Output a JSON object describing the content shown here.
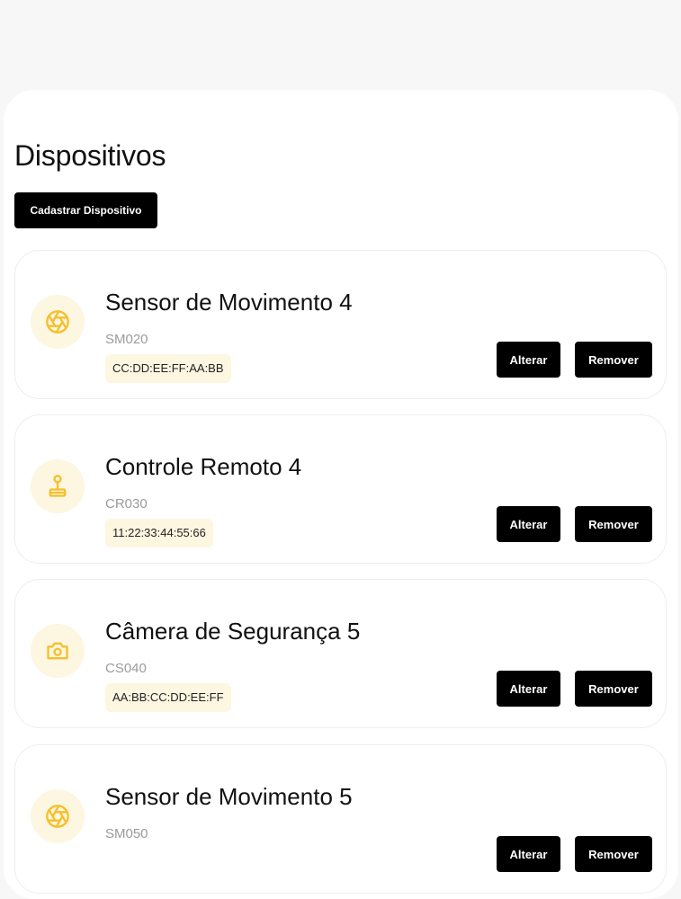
{
  "page": {
    "title": "Dispositivos",
    "add_button_label": "Cadastrar Dispositivo"
  },
  "colors": {
    "icon_accent": "#f5c02c",
    "icon_background": "#fdf6e1",
    "button_background": "#000000",
    "muted_text": "#9b9b9b"
  },
  "devices": [
    {
      "name": "Sensor de Movimento 4",
      "code": "SM020",
      "mac": "CC:DD:EE:FF:AA:BB",
      "icon": "aperture-icon",
      "edit_label": "Alterar",
      "remove_label": "Remover"
    },
    {
      "name": "Controle Remoto 4",
      "code": "CR030",
      "mac": "11:22:33:44:55:66",
      "icon": "joystick-icon",
      "edit_label": "Alterar",
      "remove_label": "Remover"
    },
    {
      "name": "Câmera de Segurança 5",
      "code": "CS040",
      "mac": "AA:BB:CC:DD:EE:FF",
      "icon": "camera-icon",
      "edit_label": "Alterar",
      "remove_label": "Remover"
    },
    {
      "name": "Sensor de Movimento 5",
      "code": "SM050",
      "mac": "",
      "icon": "aperture-icon",
      "edit_label": "Alterar",
      "remove_label": "Remover"
    }
  ]
}
